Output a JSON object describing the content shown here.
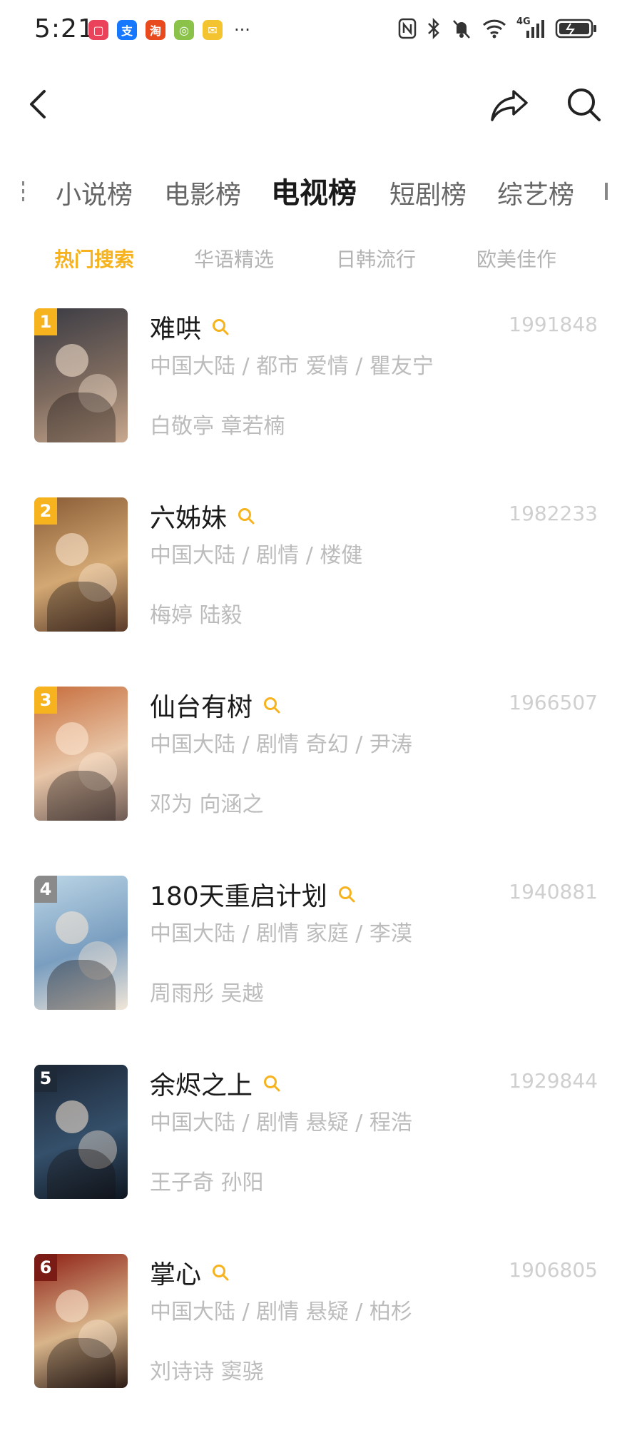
{
  "status_bar": {
    "time": "5:21",
    "more": "···",
    "app_icons": [
      {
        "name": "notification-app-icon",
        "color": "#e9425a",
        "glyph": "▢"
      },
      {
        "name": "alipay-app-icon",
        "color": "#1677ff",
        "glyph": "支"
      },
      {
        "name": "taobao-app-icon",
        "color": "#e8491d",
        "glyph": "淘"
      },
      {
        "name": "green-app-icon",
        "color": "#8bc34a",
        "glyph": "◎"
      },
      {
        "name": "mail-app-icon",
        "color": "#f4c430",
        "glyph": "✉"
      }
    ],
    "indicators": [
      "nfc-icon",
      "bluetooth-icon",
      "mute-icon",
      "wifi-icon",
      "signal-4g-icon",
      "battery-icon"
    ],
    "network_label": "4G"
  },
  "header": {
    "back_icon": "back-arrow-icon",
    "share_icon": "share-icon",
    "search_icon": "search-icon"
  },
  "category_tabs": [
    {
      "label": "小说榜",
      "active": false
    },
    {
      "label": "电影榜",
      "active": false
    },
    {
      "label": "电视榜",
      "active": true
    },
    {
      "label": "短剧榜",
      "active": false
    },
    {
      "label": "综艺榜",
      "active": false
    }
  ],
  "sub_tabs": [
    {
      "label": "热门搜索",
      "active": true
    },
    {
      "label": "华语精选",
      "active": false
    },
    {
      "label": "日韩流行",
      "active": false
    },
    {
      "label": "欧美佳作",
      "active": false
    }
  ],
  "accent_color": "#f6b31d",
  "items": [
    {
      "rank": "1",
      "title": "难哄",
      "score": "1991848",
      "meta": "中国大陆 / 都市 爱情 / 瞿友宁",
      "cast": "白敬亭 章若楠",
      "badge_color": "#f6b31d",
      "poster_colors": [
        "#3a3b44",
        "#7d6a5e",
        "#c9a98f"
      ]
    },
    {
      "rank": "2",
      "title": "六姊妹",
      "score": "1982233",
      "meta": "中国大陆 / 剧情 / 楼健",
      "cast": "梅婷 陆毅",
      "badge_color": "#f6b31d",
      "poster_colors": [
        "#8a5b35",
        "#d3a873",
        "#5a3b2a"
      ]
    },
    {
      "rank": "3",
      "title": "仙台有树",
      "score": "1966507",
      "meta": "中国大陆 / 剧情 奇幻 / 尹涛",
      "cast": "邓为 向涵之",
      "badge_color": "#f6b31d",
      "poster_colors": [
        "#c76d3c",
        "#e8c6a8",
        "#6e5a54"
      ]
    },
    {
      "rank": "4",
      "title": "180天重启计划",
      "score": "1940881",
      "meta": "中国大陆 / 剧情 家庭 / 李漠",
      "cast": "周雨彤 吴越",
      "badge_color": "#8a8a8a",
      "poster_colors": [
        "#bcd6e6",
        "#7a9ec0",
        "#f1e6d8"
      ]
    },
    {
      "rank": "5",
      "title": "余烬之上",
      "score": "1929844",
      "meta": "中国大陆 / 剧情 悬疑 / 程浩",
      "cast": "王子奇 孙阳",
      "badge_color": "#1f2a38",
      "poster_colors": [
        "#1b2433",
        "#35506b",
        "#0e1620"
      ]
    },
    {
      "rank": "6",
      "title": "掌心",
      "score": "1906805",
      "meta": "中国大陆 / 剧情 悬疑 / 柏杉",
      "cast": "刘诗诗 窦骁",
      "badge_color": "#7a1b15",
      "poster_colors": [
        "#8e1f14",
        "#d8b48a",
        "#2d1a14"
      ]
    }
  ]
}
